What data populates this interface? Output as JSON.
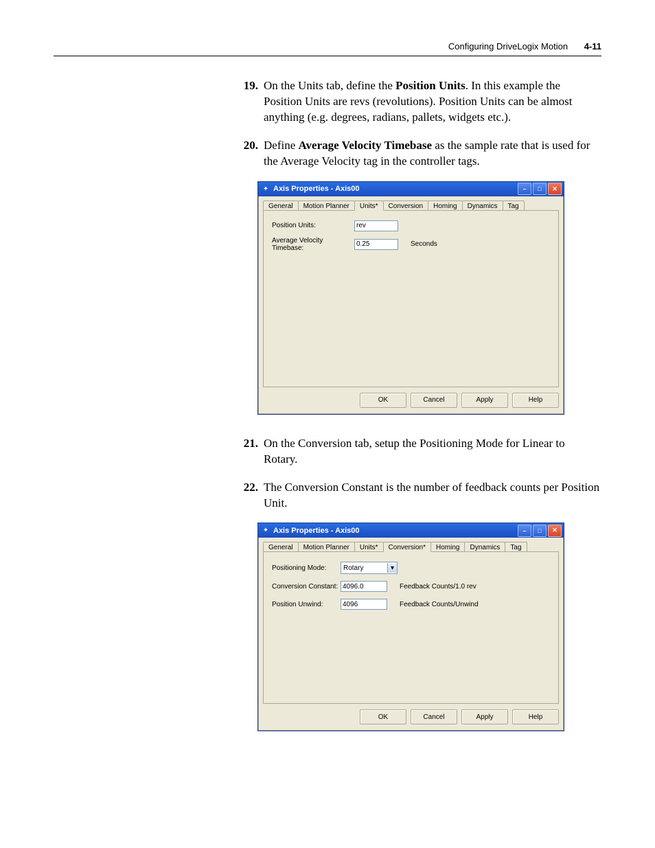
{
  "header": {
    "title": "Configuring DriveLogix Motion",
    "pageno": "4-11"
  },
  "steps": {
    "s19_num": "19.",
    "s19_body": {
      "a": "On the Units tab, define the ",
      "b": "Position Units",
      "c": ". In this example the Position Units are revs (revolutions). Position Units can be almost anything (e.g. degrees, radians, pallets, widgets etc.)."
    },
    "s20_num": "20.",
    "s20_body": {
      "a": "Define ",
      "b": "Average Velocity Timebase",
      "c": " as the sample rate that is used for the Average Velocity tag in the controller tags."
    },
    "s21_num": "21.",
    "s21_body": "On the Conversion tab, setup the Positioning Mode for Linear to Rotary.",
    "s22_num": "22.",
    "s22_body": "The Conversion Constant is the number of feedback counts per Position Unit."
  },
  "dialog1": {
    "title": "Axis Properties - Axis00",
    "tabs": [
      "General",
      "Motion Planner",
      "Units*",
      "Conversion",
      "Homing",
      "Dynamics",
      "Tag"
    ],
    "active_tab_index": 2,
    "fields": {
      "pos_units_label": "Position Units:",
      "pos_units_value": "rev",
      "avt_label": "Average Velocity Timebase:",
      "avt_value": "0.25",
      "avt_unit": "Seconds"
    },
    "buttons": {
      "ok": "OK",
      "cancel": "Cancel",
      "apply": "Apply",
      "help": "Help"
    }
  },
  "dialog2": {
    "title": "Axis Properties - Axis00",
    "tabs": [
      "General",
      "Motion Planner",
      "Units*",
      "Conversion*",
      "Homing",
      "Dynamics",
      "Tag"
    ],
    "active_tab_index": 3,
    "fields": {
      "posmode_label": "Positioning Mode:",
      "posmode_value": "Rotary",
      "cc_label": "Conversion Constant:",
      "cc_value": "4096.0",
      "cc_unit": "Feedback Counts/1.0 rev",
      "pu_label": "Position Unwind:",
      "pu_value": "4096",
      "pu_unit": "Feedback Counts/Unwind"
    },
    "buttons": {
      "ok": "OK",
      "cancel": "Cancel",
      "apply": "Apply",
      "help": "Help"
    }
  }
}
